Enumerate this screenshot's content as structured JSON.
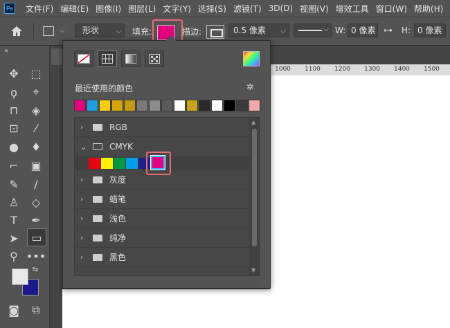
{
  "menubar": {
    "logo": "Ps",
    "items": [
      "文件(F)",
      "编辑(E)",
      "图像(I)",
      "图层(L)",
      "文字(Y)",
      "选择(S)",
      "滤镜(T)",
      "3D(D)",
      "视图(V)",
      "增效工具",
      "窗口(W)",
      "帮助(H)"
    ]
  },
  "options": {
    "mode": "形状",
    "fill_label": "填充:",
    "fill_color": "#e4007f",
    "stroke_label": "描边:",
    "stroke_width": "0.5 像素",
    "w_label": "W:",
    "w_value": "0 像素",
    "h_label": "H:",
    "h_value": "0 像素"
  },
  "ruler": {
    "ticks": [
      "1000",
      "1100",
      "1200",
      "1300",
      "1400",
      "1500"
    ]
  },
  "popup": {
    "recent_title": "最近使用的颜色",
    "recent_colors": [
      "#e4007f",
      "#1e9fe0",
      "#ffcc00",
      "#d4a400",
      "#c49a14",
      "#7a7a7a",
      "#8c8c8c",
      "#5a5a5a",
      "#ffffff",
      "#c9a21a",
      "#2a2a2a",
      "#ffffff",
      "#000000",
      "#3a3a3a",
      "#f0a8a8"
    ],
    "groups": [
      {
        "name": "RGB",
        "open": false
      },
      {
        "name": "CMYK",
        "open": true
      },
      {
        "name": "灰度",
        "open": false
      },
      {
        "name": "蜡笔",
        "open": false
      },
      {
        "name": "浅色",
        "open": false
      },
      {
        "name": "纯净",
        "open": false
      },
      {
        "name": "黑色",
        "open": false
      }
    ],
    "cmyk_colors": [
      "#e60012",
      "#fff100",
      "#009944",
      "#00a0e9",
      "#1d2088"
    ],
    "selected_color": "#e4007f"
  },
  "toolbar": {
    "fg_color": "#e8e8e8",
    "bg_color": "#1a1a8c"
  }
}
